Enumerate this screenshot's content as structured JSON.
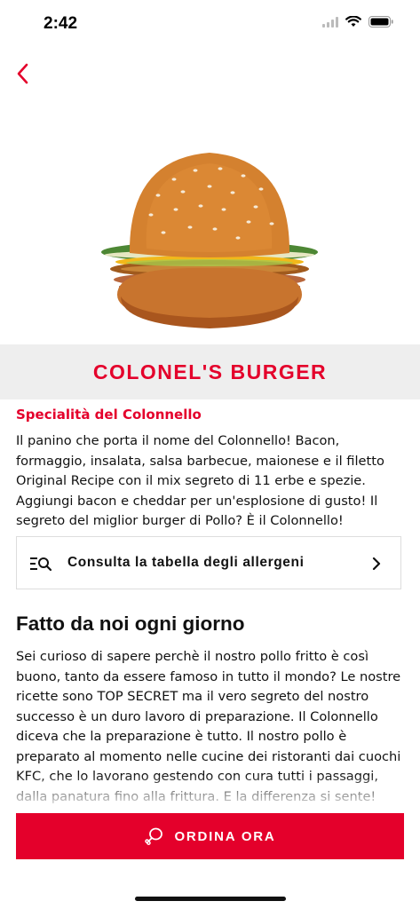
{
  "status_bar": {
    "time": "2:42"
  },
  "colors": {
    "brand_red": "#e4002b",
    "band_gray": "#eeeeee"
  },
  "nav": {
    "back_icon": "chevron-left-icon"
  },
  "hero": {
    "image": "burger-image"
  },
  "product": {
    "title": "COLONEL'S BURGER",
    "subtitle": "Specialità del Colonnello",
    "description": "Il panino che porta il nome del Colonnello! Bacon, formaggio, insalata, salsa barbecue, maionese e il filetto Original Recipe con il mix segreto di 11 erbe e spezie. Aggiungi bacon e cheddar per un'esplosione di gusto! Il segreto del miglior burger di Pollo? È il Colonnello!"
  },
  "allergens": {
    "label": "Consulta la tabella degli allergeni",
    "icon": "list-search-icon",
    "chevron_icon": "chevron-right-icon"
  },
  "section": {
    "heading": "Fatto da noi ogni giorno",
    "body": "Sei curioso di sapere perchè il nostro pollo fritto è così buono, tanto da essere famoso in tutto il mondo? Le nostre ricette sono TOP SECRET ma il vero segreto del nostro successo è un duro lavoro di preparazione. Il Colonnello diceva che la preparazione è tutto. Il nostro pollo è preparato al momento nelle cucine dei ristoranti dai cuochi KFC, che lo lavorano gestendo con cura tutti i passaggi, dalla panatura fino alla frittura. E la differenza si sente!"
  },
  "order_button": {
    "label": "ORDINA ORA",
    "icon": "chicken-drumstick-icon"
  }
}
